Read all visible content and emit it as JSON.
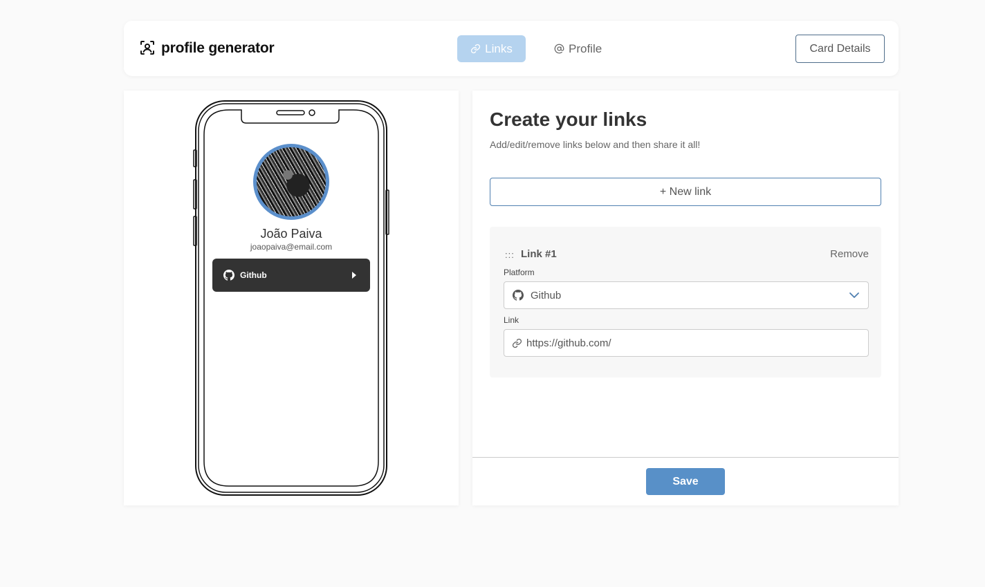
{
  "header": {
    "brand_icon": "user-scan-icon",
    "brand_text": "profile generator",
    "tabs": [
      {
        "label": "Links",
        "icon": "link-icon",
        "active": true
      },
      {
        "label": "Profile",
        "icon": "at-sign-icon",
        "active": false
      }
    ],
    "card_details_label": "Card Details"
  },
  "preview": {
    "name": "João Paiva",
    "email": "joaopaiva@email.com",
    "links": [
      {
        "platform": "Github",
        "icon": "github-icon"
      }
    ]
  },
  "editor": {
    "title": "Create your links",
    "subtitle": "Add/edit/remove links below and then share it all!",
    "new_link_label": "+ New link",
    "link_card": {
      "handle": ":::",
      "title": "Link #1",
      "remove_label": "Remove",
      "platform_label": "Platform",
      "platform_value": "Github",
      "link_label": "Link",
      "link_value": "https://github.com/"
    },
    "save_label": "Save"
  },
  "colors": {
    "accent": "#5890c8",
    "tab_active_bg": "#b5d3ef",
    "preview_button_bg": "#333333",
    "avatar_ring": "#5b8fcb"
  }
}
